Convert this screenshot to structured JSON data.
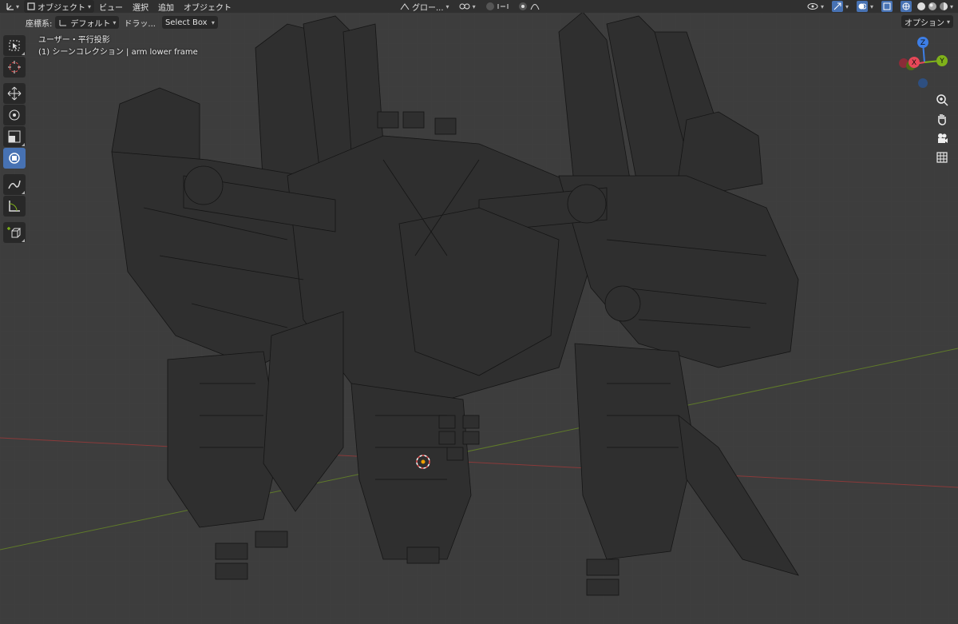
{
  "header": {
    "mode_label": "オブジェクト",
    "menu": [
      "ビュー",
      "選択",
      "追加",
      "オブジェクト"
    ],
    "transform_orientation": "グロー..."
  },
  "tool_header": {
    "coord_label": "座標系:",
    "coord_value": "デフォルト",
    "drag_label": "ドラッ...",
    "drag_value": "Select Box",
    "options_label": "オプション"
  },
  "viewport": {
    "view_name": "ユーザー・平行投影",
    "collection_info": "(1) シーンコレクション | arm lower frame"
  },
  "gizmo": {
    "axes": {
      "x": "X",
      "y": "Y",
      "z": "Z"
    },
    "colors": {
      "x": "#e64858",
      "y": "#7fb21a",
      "z": "#3d7ee6"
    }
  },
  "toolbar": {
    "tools": [
      "select-box",
      "cursor",
      "move",
      "rotate",
      "scale",
      "transform",
      "annotate",
      "measure",
      "add-cube"
    ],
    "active": "transform"
  },
  "colors": {
    "background": "#3d3d3d",
    "header": "#303030",
    "accent": "#4772b3",
    "wire": "#1a1a1a",
    "x_axis_line": "#8a3a3a",
    "y_axis_line": "#5f7a2a"
  }
}
